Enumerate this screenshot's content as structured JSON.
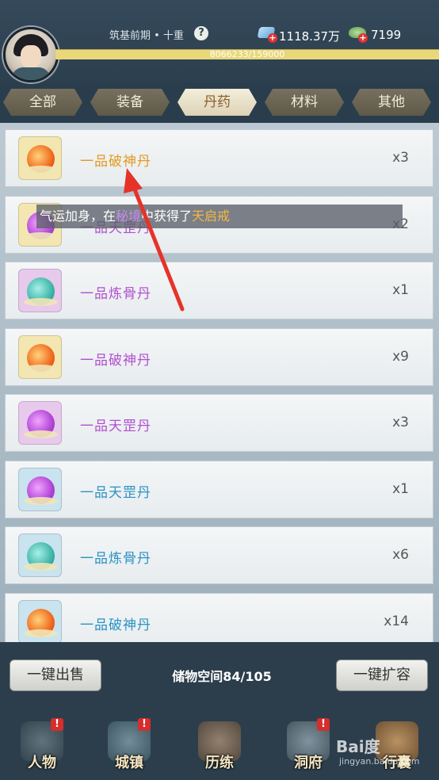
{
  "header": {
    "realm": "筑基前期 • 十重",
    "help_icon": "?",
    "spirit_stones": "1118.37万",
    "jade": "7199",
    "exp": "8066233/159000",
    "plus": "+"
  },
  "tabs": [
    {
      "label": "全部"
    },
    {
      "label": "装备"
    },
    {
      "label": "丹药"
    },
    {
      "label": "材料"
    },
    {
      "label": "其他"
    }
  ],
  "active_tab": "丹药",
  "items": [
    {
      "name": "一品破神丹",
      "qty": "x3",
      "name_color": "#e39a1f",
      "icon": "orange-pill-icon"
    },
    {
      "name": "一品天罡丹",
      "qty": "x2",
      "name_color": "#b24fd0",
      "icon": "purple-pill-icon"
    },
    {
      "name": "一品炼骨丹",
      "qty": "x1",
      "name_color": "#b24fd0",
      "icon": "teal-pill-icon"
    },
    {
      "name": "一品破神丹",
      "qty": "x9",
      "name_color": "#b24fd0",
      "icon": "orange-pill-icon"
    },
    {
      "name": "一品天罡丹",
      "qty": "x3",
      "name_color": "#b24fd0",
      "icon": "purple-pill-icon"
    },
    {
      "name": "一品天罡丹",
      "qty": "x1",
      "name_color": "#2a92c4",
      "icon": "purple-pill-icon"
    },
    {
      "name": "一品炼骨丹",
      "qty": "x6",
      "name_color": "#2a92c4",
      "icon": "teal-pill-icon"
    },
    {
      "name": "一品破神丹",
      "qty": "x14",
      "name_color": "#2a92c4",
      "icon": "orange-pill-icon"
    }
  ],
  "notice": {
    "prefix": "气运加身，在",
    "place": "秘境",
    "middle": "中获得了",
    "item": "天启戒"
  },
  "footer": {
    "sell_all": "一键出售",
    "storage": "储物空间84/105",
    "expand": "一键扩容"
  },
  "nav": [
    {
      "label": "人物",
      "badge": "!"
    },
    {
      "label": "城镇",
      "badge": "!"
    },
    {
      "label": "历练",
      "badge": ""
    },
    {
      "label": "洞府",
      "badge": "!"
    },
    {
      "label": "行囊",
      "badge": ""
    }
  ],
  "watermark": {
    "logo": "Bai度",
    "sub": "jingyan.baidu.com"
  },
  "colors": {
    "header_bg": "#2c3f4f",
    "exp_bar": "#e9d77a",
    "tab_active": "#f3eedb",
    "badge": "#d62d2d",
    "arrow": "#e5332a"
  }
}
